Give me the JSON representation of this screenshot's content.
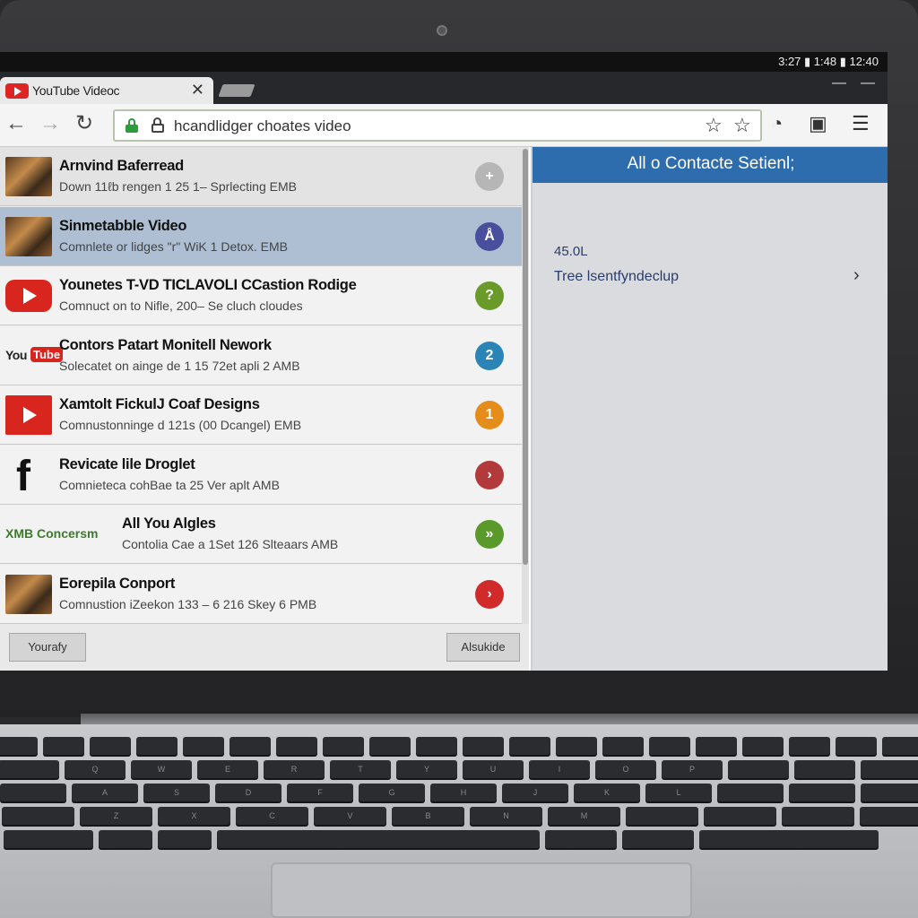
{
  "status_bar": {
    "text": "3:27 ▮ 1:48 ▮ 12:40"
  },
  "tab": {
    "title": "YouTube Videoc"
  },
  "address": {
    "url": "hcandlidger choates video"
  },
  "list": [
    {
      "title": "Arnvind Baferread",
      "subtitle": "Down 11ℓb rengen 1 25 1– Sprlecting EMB",
      "action_icon": "+",
      "action_color": "#b6b6b6",
      "thumb": "photo"
    },
    {
      "title": "Sinmetabble Video",
      "subtitle": "Comnlete or lidges \"r\" WiK 1 Detox. EMB",
      "action_icon": "Å",
      "action_color": "#4a4f9d",
      "thumb": "photo"
    },
    {
      "title": "Younetes T-VD TICLAVOLI CCastion Rodige",
      "subtitle": "Comnuct on to Nifle, 200– Se cluch cloudes",
      "action_icon": "?",
      "action_color": "#6a9a2a",
      "thumb": "youtube-play"
    },
    {
      "title": "Contors Patart Monitell Nework",
      "subtitle": "Solecatet on ainge de 1 15 72et apli 2 AMB",
      "action_icon": "2",
      "action_color": "#2a84b6",
      "thumb": "youtube-logo"
    },
    {
      "title": "Xamtolt FickulJ Coaf Designs",
      "subtitle": "Comnustonninge d 121s (00 Dcangel) EMB",
      "action_icon": "1",
      "action_color": "#e58d1a",
      "thumb": "youtube-play-large"
    },
    {
      "title": "Revicate lile Droglet",
      "subtitle": "Comnieteca cohBae ta 25 Ver aplt AMB",
      "action_icon": "›",
      "action_color": "#b33a3a",
      "thumb": "facebook"
    },
    {
      "title": "All You Algles",
      "subtitle": "Contolia Cae a 1Set 126 Slteaars AMB",
      "action_icon": "»",
      "action_color": "#5a9a2a",
      "thumb": "xmb-text",
      "thumb_text": "XMB Concersm"
    },
    {
      "title": "Eorepila Conport",
      "subtitle": "Comnustion iZeekon 133 – 6 216 Skey 6 PMB",
      "action_icon": "›",
      "action_color": "#d02a2a",
      "thumb": "photo"
    }
  ],
  "buttons": {
    "left": "Yourafy",
    "right": "Alsukide"
  },
  "right_pane": {
    "header": "All o Contacte Setienl;",
    "value": "45.0L",
    "item": "Tree lsentfyndeclup",
    "item_chevron": "›"
  },
  "keyboard": {
    "rows": [
      [
        "",
        "",
        "",
        "",
        "",
        "",
        "",
        "",
        "",
        "",
        "",
        "",
        "",
        "",
        "",
        "",
        "",
        "",
        "",
        ""
      ],
      [
        "",
        "Q",
        "W",
        "E",
        "R",
        "T",
        "Y",
        "U",
        "I",
        "O",
        "P",
        "",
        "",
        ""
      ],
      [
        "",
        "A",
        "S",
        "D",
        "F",
        "G",
        "H",
        "J",
        "K",
        "L",
        "",
        "",
        ""
      ],
      [
        "",
        "Z",
        "X",
        "C",
        "V",
        "B",
        "N",
        "M",
        "",
        "",
        "",
        ""
      ],
      [
        "",
        "",
        "",
        "",
        "",
        "",
        ""
      ]
    ]
  }
}
